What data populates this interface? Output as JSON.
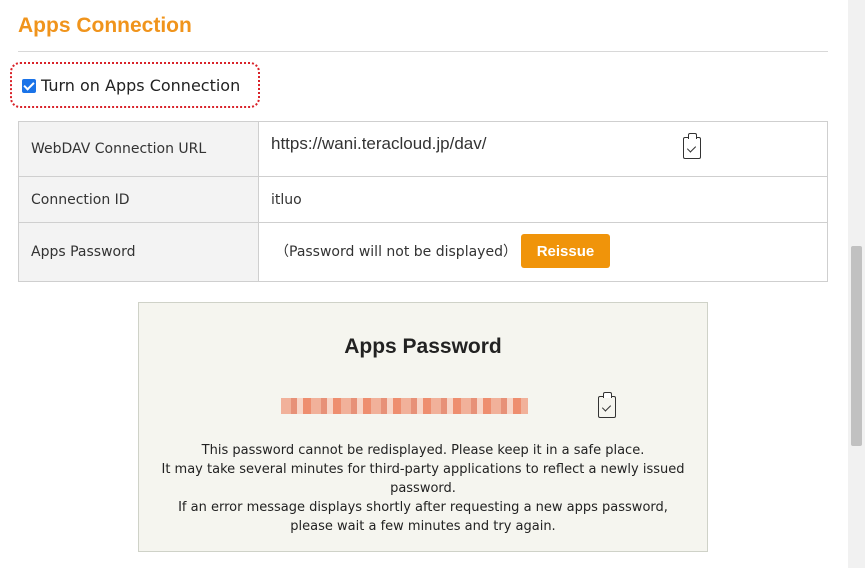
{
  "section": {
    "title": "Apps Connection"
  },
  "toggle": {
    "label": "Turn on Apps Connection",
    "checked": true
  },
  "table": {
    "rows": [
      {
        "label": "WebDAV Connection URL",
        "value": "https://wani.teracloud.jp/dav/"
      },
      {
        "label": "Connection ID",
        "value": "itluo"
      },
      {
        "label": "Apps Password",
        "value": "（Password will not be displayed）",
        "button": "Reissue"
      }
    ]
  },
  "panel": {
    "title": "Apps Password",
    "messages": [
      "This password cannot be redisplayed. Please keep it in a safe place.",
      "It may take several minutes for third-party applications to reflect a newly issued password.",
      "If an error message displays shortly after requesting a new apps password, please wait a few minutes and try again."
    ]
  },
  "icons": {
    "copy": "clipboard-check-icon"
  },
  "colors": {
    "accent": "#f0941c",
    "button": "#f0940a",
    "highlight_border": "#d9232a"
  }
}
